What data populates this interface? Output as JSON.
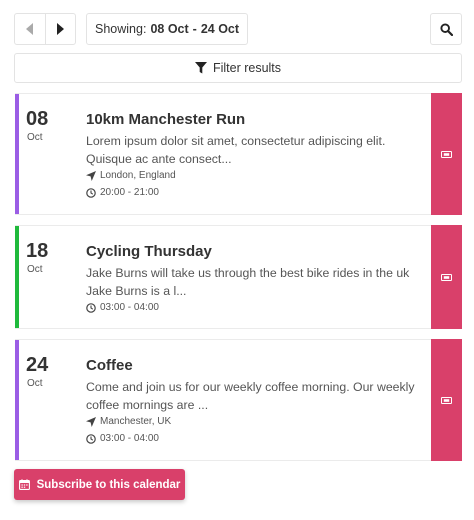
{
  "toolbar": {
    "showing_label": "Showing:",
    "range_start": "08 Oct",
    "range_separator": "-",
    "range_end": "24 Oct",
    "prev_icon": "chevron-left",
    "next_icon": "chevron-right",
    "search_icon": "search"
  },
  "filter": {
    "label": "Filter results",
    "icon": "filter"
  },
  "events": [
    {
      "day": "08",
      "month": "Oct",
      "title": "10km Manchester Run",
      "description": "Lorem ipsum dolor sit amet, consectetur adipiscing elit. Quisque ac ante consect...",
      "location": "London, England",
      "time": "20:00 - 21:00",
      "accent_color": "#9b5de5"
    },
    {
      "day": "18",
      "month": "Oct",
      "title": "Cycling Thursday",
      "description": "Jake Burns will take us through the best bike rides in the uk Jake Burns is a l...",
      "time": "03:00 - 04:00",
      "accent_color": "#1fba3c"
    },
    {
      "day": "24",
      "month": "Oct",
      "title": "Coffee",
      "description": "Come and join us for our weekly coffee morning. Our weekly coffee mornings are ...",
      "location": "Manchester, UK",
      "time": "03:00 - 04:00",
      "accent_color": "#9b5de5"
    }
  ],
  "ticket_color": "#d9406a",
  "subscribe": {
    "label": "Subscribe to this calendar",
    "icon": "calendar"
  }
}
